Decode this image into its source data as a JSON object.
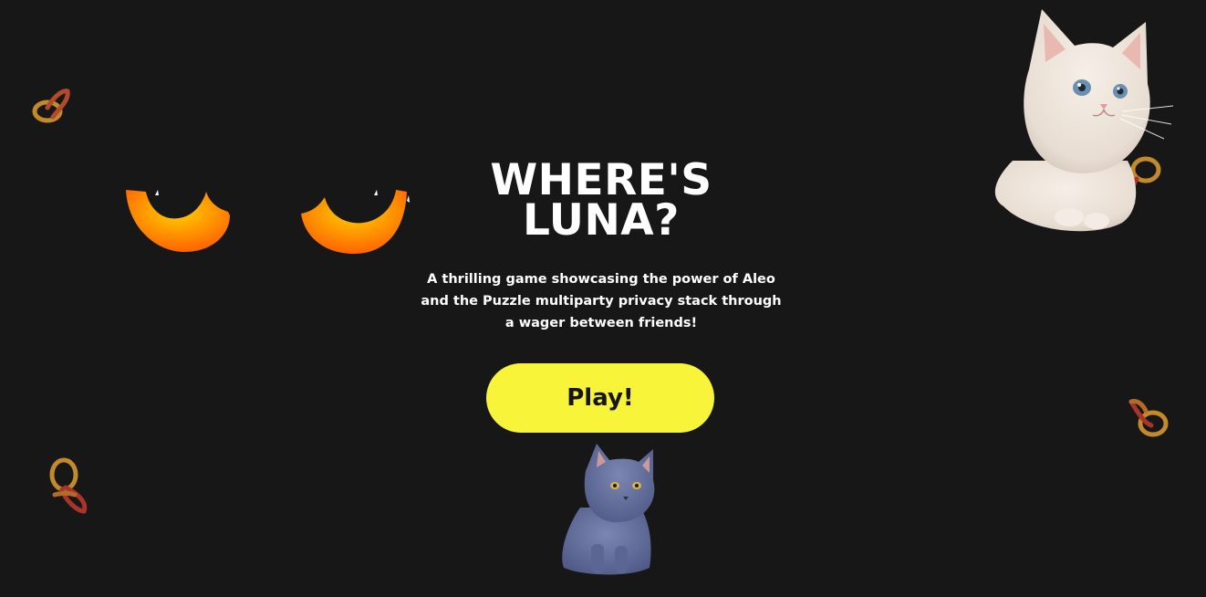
{
  "title": {
    "line1": "WHERE'S",
    "line2": "LUNA?"
  },
  "subtitle": "A thrilling game showcasing the power of Aleo and the Puzzle multiparty privacy stack through a wager between friends!",
  "play_label": "Play!",
  "colors": {
    "background": "#171717",
    "button": "#f7f43a",
    "eye_orange": "#ff7a00",
    "pretzel": "#c28a2a"
  },
  "decorations": [
    "cat-eyes",
    "white-kitten",
    "gray-cat",
    "pretzel-icon"
  ]
}
